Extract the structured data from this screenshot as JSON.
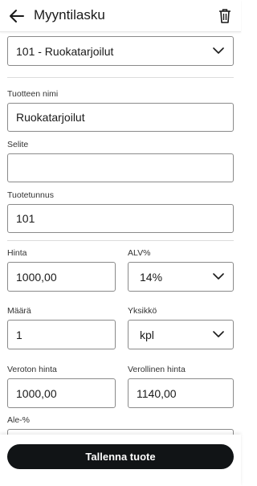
{
  "appbar": {
    "title": "Myyntilasku",
    "back_icon": "arrow-left-icon",
    "delete_icon": "trash-icon"
  },
  "product_select": {
    "value": "101 - Ruokatarjoilut"
  },
  "form": {
    "product_name": {
      "label": "Tuotteen nimi",
      "value": "Ruokatarjoilut"
    },
    "description": {
      "label": "Selite",
      "value": ""
    },
    "product_code": {
      "label": "Tuotetunnus",
      "value": "101"
    },
    "price": {
      "label": "Hinta",
      "value": "1000,00"
    },
    "vat": {
      "label": "ALV%",
      "value": "14%"
    },
    "quantity": {
      "label": "Määrä",
      "value": "1"
    },
    "unit": {
      "label": "Yksikkö",
      "value": "kpl"
    },
    "net_price": {
      "label": "Veroton hinta",
      "value": "1000,00"
    },
    "gross_price": {
      "label": "Verollinen hinta",
      "value": "1140,00"
    },
    "discount": {
      "label": "Ale-%",
      "value": ""
    }
  },
  "actions": {
    "save_label": "Tallenna tuote"
  },
  "colors": {
    "primary_button": "#111416",
    "border": "#8a8a8a",
    "text": "#1a1a1a"
  }
}
